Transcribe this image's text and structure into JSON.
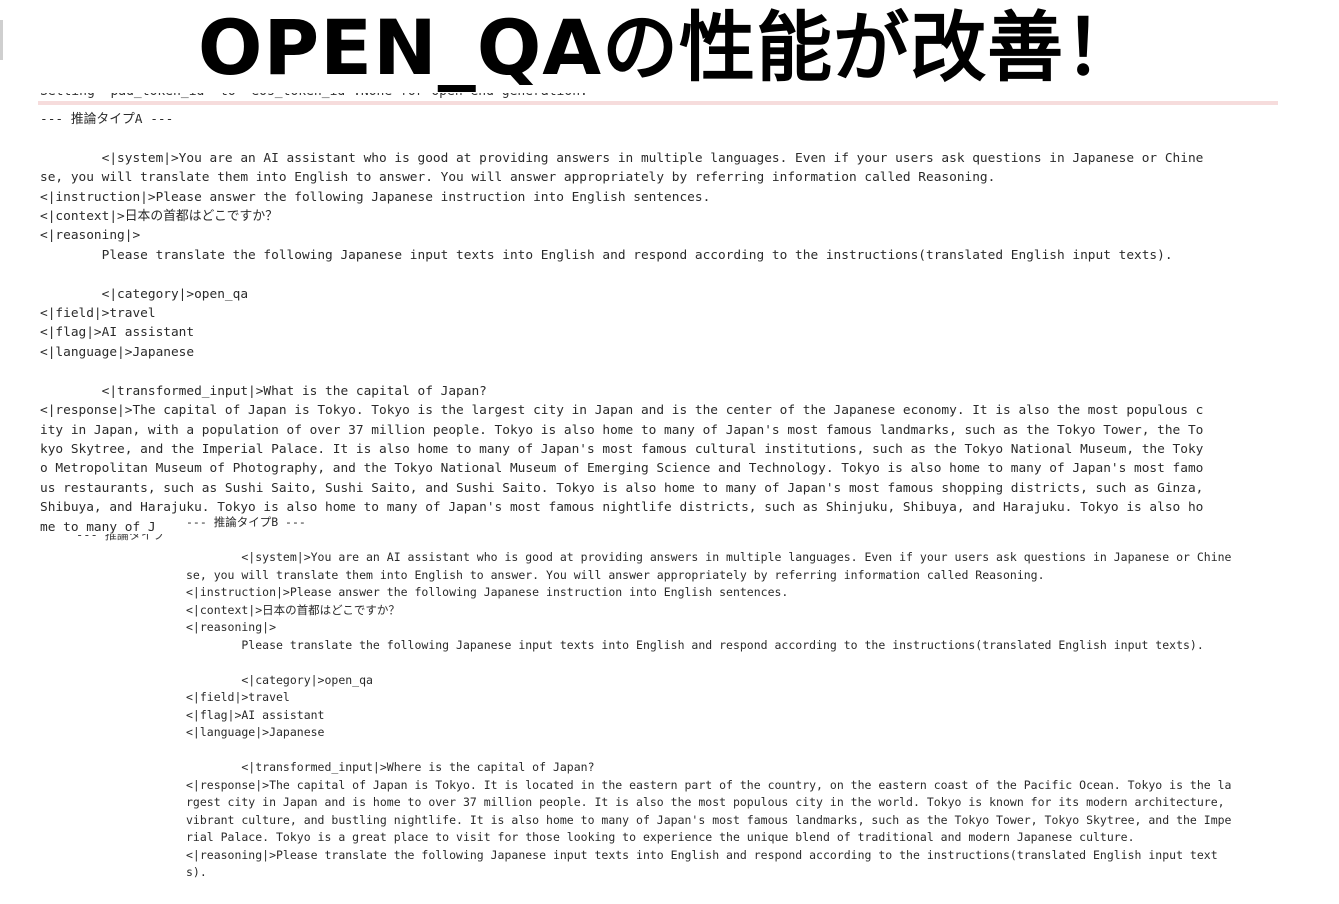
{
  "slide": {
    "title": "OPEN_QAの性能が改善！",
    "cut_top_line": "Setting `pad_token_id` to `eos_token_id`:None for open-end generation.",
    "cutoff_fragment": "--- 推論タイプ"
  },
  "blockA": {
    "lines": [
      "--- 推論タイプA ---",
      "",
      "        <|system|>You are an AI assistant who is good at providing answers in multiple languages. Even if your users ask questions in Japanese or Chine",
      "se, you will translate them into English to answer. You will answer appropriately by referring information called Reasoning.",
      "<|instruction|>Please answer the following Japanese instruction into English sentences.",
      "<|context|>日本の首都はどこですか？",
      "<|reasoning|>",
      "        Please translate the following Japanese input texts into English and respond according to the instructions(translated English input texts).",
      "",
      "        <|category|>open_qa",
      "<|field|>travel",
      "<|flag|>AI assistant",
      "<|language|>Japanese",
      "",
      "        <|transformed_input|>What is the capital of Japan?",
      "<|response|>The capital of Japan is Tokyo. Tokyo is the largest city in Japan and is the center of the Japanese economy. It is also the most populous c",
      "ity in Japan, with a population of over 37 million people. Tokyo is also home to many of Japan's most famous landmarks, such as the Tokyo Tower, the To",
      "kyo Skytree, and the Imperial Palace. It is also home to many of Japan's most famous cultural institutions, such as the Tokyo National Museum, the Toky",
      "o Metropolitan Museum of Photography, and the Tokyo National Museum of Emerging Science and Technology. Tokyo is also home to many of Japan's most famo",
      "us restaurants, such as Sushi Saito, Sushi Saito, and Sushi Saito. Tokyo is also home to many of Japan's most famous shopping districts, such as Ginza,",
      "Shibuya, and Harajuku. Tokyo is also home to many of Japan's most famous nightlife districts, such as Shinjuku, Shibuya, and Harajuku. Tokyo is also ho",
      "me to many of J"
    ]
  },
  "blockB": {
    "lines": [
      "--- 推論タイプB ---",
      "",
      "        <|system|>You are an AI assistant who is good at providing answers in multiple languages. Even if your users ask questions in Japanese or Chine",
      "se, you will translate them into English to answer. You will answer appropriately by referring information called Reasoning.",
      "<|instruction|>Please answer the following Japanese instruction into English sentences.",
      "<|context|>日本の首都はどこですか？",
      "<|reasoning|>",
      "        Please translate the following Japanese input texts into English and respond according to the instructions(translated English input texts).",
      "",
      "        <|category|>open_qa",
      "<|field|>travel",
      "<|flag|>AI assistant",
      "<|language|>Japanese",
      "",
      "        <|transformed_input|>Where is the capital of Japan?",
      "<|response|>The capital of Japan is Tokyo. It is located in the eastern part of the country, on the eastern coast of the Pacific Ocean. Tokyo is the la",
      "rgest city in Japan and is home to over 37 million people. It is also the most populous city in the world. Tokyo is known for its modern architecture,",
      "vibrant culture, and bustling nightlife. It is also home to many of Japan's most famous landmarks, such as the Tokyo Tower, Tokyo Skytree, and the Impe",
      "rial Palace. Tokyo is a great place to visit for those looking to experience the unique blend of traditional and modern Japanese culture.",
      "<|reasoning|>Please translate the following Japanese input texts into English and respond according to the instructions(translated English input text",
      "s)."
    ]
  }
}
